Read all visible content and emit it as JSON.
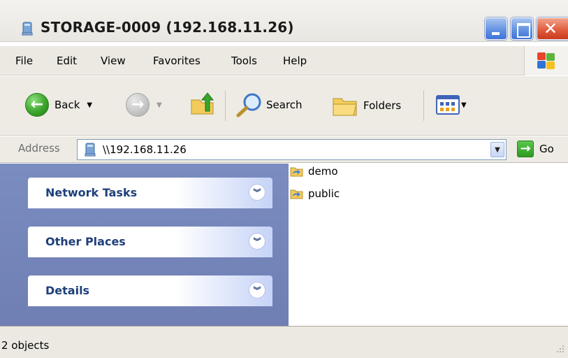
{
  "window": {
    "title": "STORAGE-0009 (192.168.11.26)"
  },
  "menu": {
    "items": [
      "File",
      "Edit",
      "View",
      "Favorites",
      "Tools",
      "Help"
    ]
  },
  "toolbar": {
    "back_label": "Back",
    "search_label": "Search",
    "folders_label": "Folders"
  },
  "address": {
    "label": "Address",
    "value": "\\\\192.168.11.26",
    "go_label": "Go"
  },
  "taskpane": {
    "panels": [
      {
        "title": "Network Tasks"
      },
      {
        "title": "Other Places"
      },
      {
        "title": "Details"
      }
    ]
  },
  "files": {
    "items": [
      {
        "name": "demo",
        "icon": "shared-folder-icon"
      },
      {
        "name": "public",
        "icon": "shared-folder-icon"
      }
    ]
  },
  "status": {
    "text": "2 objects"
  },
  "colors": {
    "taskpane_bg": "#6f7fb4",
    "panel_title": "#1e3f7a",
    "titlebar_close": "#e0583a",
    "titlebar_button": "#5f8fe0"
  }
}
